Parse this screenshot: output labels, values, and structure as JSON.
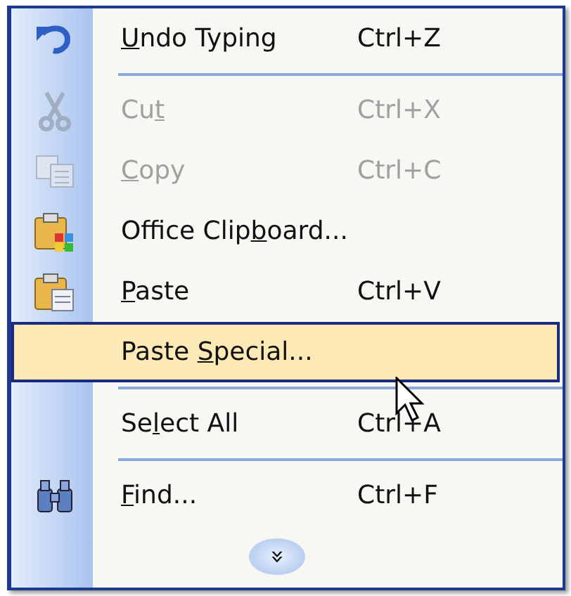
{
  "menu": {
    "items": [
      {
        "kind": "item",
        "mnemonic": "U",
        "after": "ndo Typing",
        "shortcut": "Ctrl+Z",
        "disabled": false,
        "selected": false
      },
      {
        "kind": "separator"
      },
      {
        "kind": "item",
        "before": "Cu",
        "mnemonic": "t",
        "shortcut": "Ctrl+X",
        "disabled": true,
        "selected": false
      },
      {
        "kind": "item",
        "mnemonic": "C",
        "after": "opy",
        "shortcut": "Ctrl+C",
        "disabled": true,
        "selected": false
      },
      {
        "kind": "item",
        "before": "Office Clip",
        "mnemonic": "b",
        "after": "oard...",
        "disabled": false,
        "selected": false
      },
      {
        "kind": "item",
        "mnemonic": "P",
        "after": "aste",
        "shortcut": "Ctrl+V",
        "disabled": false,
        "selected": false
      },
      {
        "kind": "item",
        "before": "Paste ",
        "mnemonic": "S",
        "after": "pecial...",
        "disabled": false,
        "selected": true
      },
      {
        "kind": "separator"
      },
      {
        "kind": "item",
        "before": "Se",
        "mnemonic": "l",
        "after": "ect All",
        "shortcut": "Ctrl+A",
        "disabled": false,
        "selected": false
      },
      {
        "kind": "separator"
      },
      {
        "kind": "item",
        "mnemonic": "F",
        "after": "ind...",
        "shortcut": "Ctrl+F",
        "disabled": false,
        "selected": false
      }
    ],
    "expand": "»"
  }
}
